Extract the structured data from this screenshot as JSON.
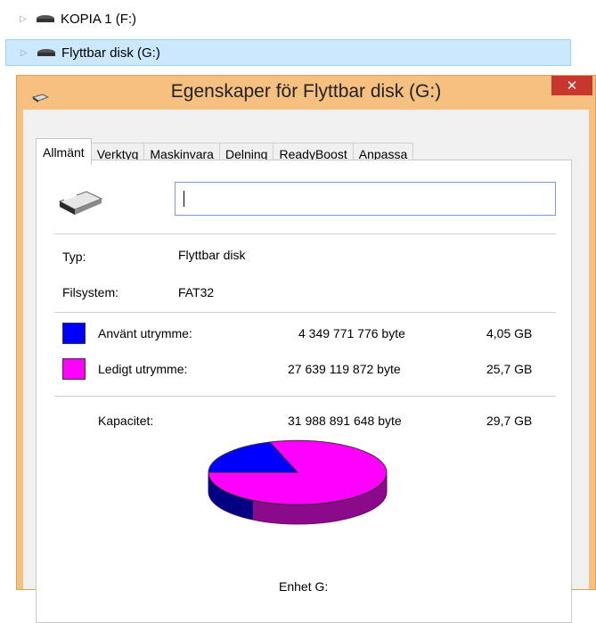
{
  "explorer": {
    "rows": [
      {
        "label": "KOPIA 1 (F:)"
      },
      {
        "label": "Flyttbar disk (G:)"
      }
    ]
  },
  "dialog": {
    "title": "Egenskaper för Flyttbar disk (G:)",
    "close_label": "✕",
    "tabs": [
      {
        "label": "Allmänt",
        "active": true
      },
      {
        "label": "Verktyg"
      },
      {
        "label": "Maskinvara"
      },
      {
        "label": "Delning"
      },
      {
        "label": "ReadyBoost"
      },
      {
        "label": "Anpassa"
      }
    ],
    "name_input": {
      "value": ""
    },
    "type_label": "Typ:",
    "type_value": "Flyttbar disk",
    "fs_label": "Filsystem:",
    "fs_value": "FAT32",
    "used": {
      "label": "Använt utrymme:",
      "bytes": "4 349 771 776 byte",
      "size": "4,05 GB",
      "color": "#0000ff"
    },
    "free": {
      "label": "Ledigt utrymme:",
      "bytes": "27 639 119 872 byte",
      "size": "25,7 GB",
      "color": "#ff00ff"
    },
    "capacity": {
      "label": "Kapacitet:",
      "bytes": "31 988 891 648 byte",
      "size": "29,7 GB"
    },
    "drive_label": "Enhet G:",
    "used_fraction": 0.136
  },
  "colors": {
    "accent_titlebar": "#f5c080",
    "close_button": "#c7372f",
    "selection": "#cce8ff"
  }
}
